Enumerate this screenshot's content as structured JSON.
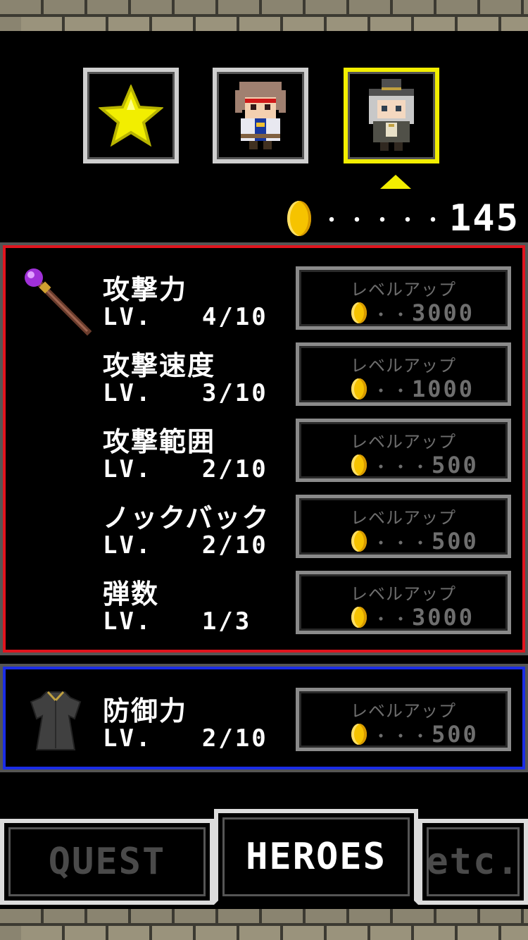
{
  "heroes": [
    {
      "name": "star-icon",
      "selected": false
    },
    {
      "name": "warrior-portrait",
      "selected": false
    },
    {
      "name": "mage-portrait",
      "selected": true
    }
  ],
  "coins": {
    "dots": "・・・・・",
    "amount": "145"
  },
  "attack_panel": {
    "stats": [
      {
        "name": "攻撃力",
        "level": "LV.   4/10",
        "button_label": "レベルアップ",
        "dots": "・・",
        "cost": "3000"
      },
      {
        "name": "攻撃速度",
        "level": "LV.   3/10",
        "button_label": "レベルアップ",
        "dots": "・・",
        "cost": "1000"
      },
      {
        "name": "攻撃範囲",
        "level": "LV.   2/10",
        "button_label": "レベルアップ",
        "dots": "・・・",
        "cost": "500"
      },
      {
        "name": "ノックバック",
        "level": "LV.   2/10",
        "button_label": "レベルアップ",
        "dots": "・・・",
        "cost": "500"
      },
      {
        "name": "弾数",
        "level": "LV.   1/3",
        "button_label": "レベルアップ",
        "dots": "・・",
        "cost": "3000"
      }
    ]
  },
  "defense_panel": {
    "stats": [
      {
        "name": "防御力",
        "level": "LV.   2/10",
        "button_label": "レベルアップ",
        "dots": "・・・",
        "cost": "500"
      }
    ]
  },
  "tabs": [
    {
      "label": "QUEST",
      "active": false
    },
    {
      "label": "HEROES",
      "active": true
    },
    {
      "label": "etc.",
      "active": false
    }
  ],
  "colors": {
    "selected": "#f2ee00",
    "attack_border": "#e0141e",
    "defense_border": "#1b2de6",
    "coin": "#f6c300"
  }
}
